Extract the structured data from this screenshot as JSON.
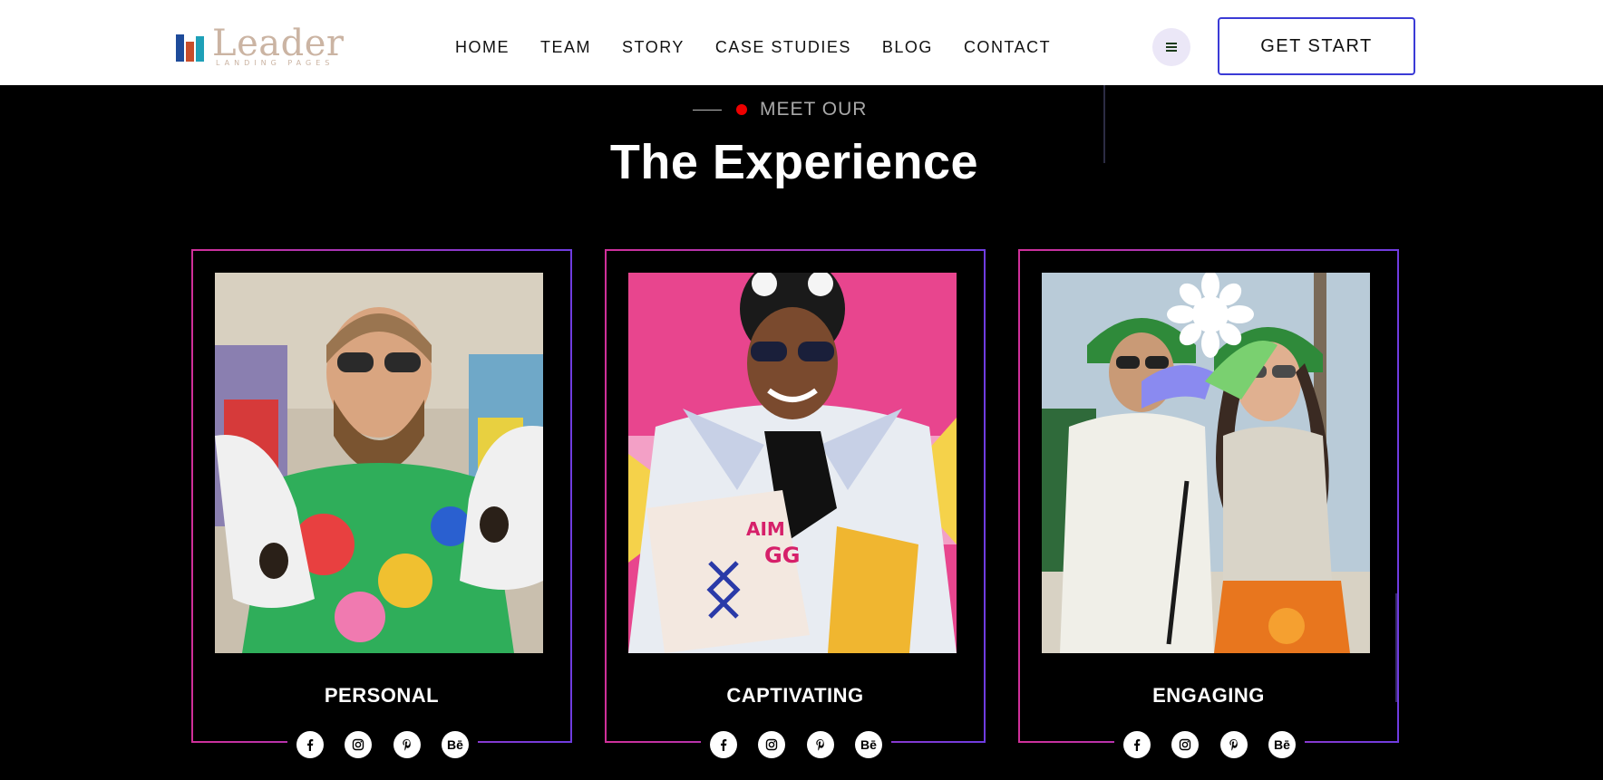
{
  "brand": {
    "name": "Leader",
    "tagline": "LANDING PAGES"
  },
  "nav": {
    "items": [
      "HOME",
      "TEAM",
      "STORY",
      "CASE STUDIES",
      "BLOG",
      "CONTACT"
    ]
  },
  "header": {
    "menu_icon": "hamburger-icon",
    "cta_label": "GET START"
  },
  "section": {
    "eyebrow": "MEET OUR",
    "title": "The Experience"
  },
  "cards": [
    {
      "label": "PERSONAL"
    },
    {
      "label": "CAPTIVATING"
    },
    {
      "label": "ENGAGING"
    }
  ],
  "social_icons": [
    "facebook-icon",
    "instagram-icon",
    "pinterest-icon",
    "behance-icon"
  ],
  "colors": {
    "accent_red": "#e00000",
    "cta_border": "#3b3bd6",
    "card_border_start": "#d0309a",
    "card_border_end": "#6f3ce0",
    "logo_tan": "#cbb4a3"
  }
}
